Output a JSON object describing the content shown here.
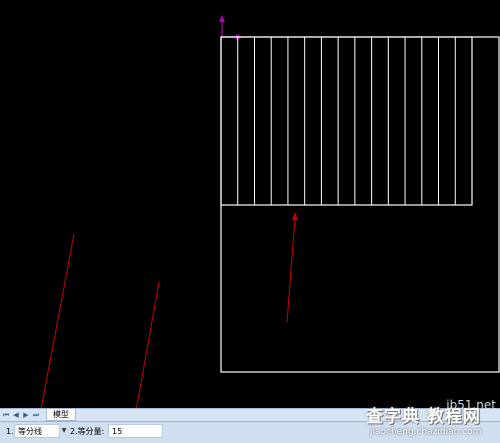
{
  "tab_bar": {
    "nav_buttons": [
      "⏮",
      "◀",
      "▶",
      "⏭"
    ],
    "model_tab_label": "模型"
  },
  "command_bar": {
    "field1_label": "1.",
    "field1_value": "等分线",
    "field2_label": "2.等分量:",
    "field2_value": "15"
  },
  "watermark": {
    "site_name": "查字典 教程网",
    "domain": "jb51.net",
    "url": "jiaocheng.chazidian.com"
  },
  "colors": {
    "background": "#000000",
    "drawing_lines": "#ffffff",
    "annotation_arrows": "#cc0000",
    "ucs_icon": "#b000b0"
  },
  "drawing": {
    "hatch_divisions": 15
  }
}
